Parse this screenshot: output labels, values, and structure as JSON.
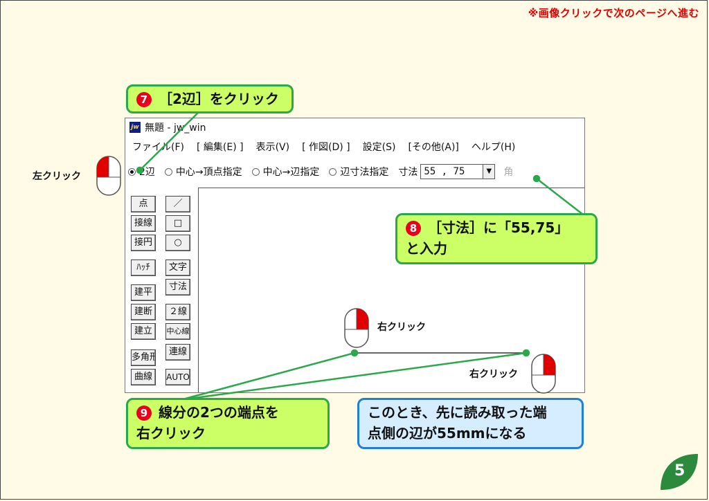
{
  "page": {
    "nav_note": "※画像クリックで次のページへ進む",
    "page_number": "5"
  },
  "window": {
    "icon_text": "jw",
    "title": "無題 - jw_win",
    "menu": [
      {
        "label": "ファイル(F)"
      },
      {
        "label": "[ 編集(E) ]"
      },
      {
        "label": "表示(V)"
      },
      {
        "label": "[ 作図(D) ]"
      },
      {
        "label": "設定(S)"
      },
      {
        "label": "[その他(A)]"
      },
      {
        "label": "ヘルプ(H)"
      }
    ],
    "toolbar": {
      "options": [
        {
          "label": "2辺",
          "selected": true
        },
        {
          "label": "中心→頂点指定",
          "selected": false
        },
        {
          "label": "中心→辺指定",
          "selected": false
        },
        {
          "label": "辺寸法指定",
          "selected": false
        }
      ],
      "size_label": "寸法",
      "size_value": "55 , 75",
      "overflow_text": "角"
    },
    "tools_left": [
      "点",
      "接線",
      "接円",
      "ﾊｯﾁ",
      "建平",
      "建断",
      "建立",
      "多角形",
      "曲線"
    ],
    "tools_right": [
      "／",
      "□",
      "○",
      "文字",
      "寸法",
      "２線",
      "中心線",
      "連線",
      "AUTO"
    ]
  },
  "callouts": {
    "step7": {
      "number": "7",
      "text": "［2辺］をクリック"
    },
    "step8": {
      "number": "8",
      "line1": "［寸法］に「55,75」",
      "line2": "と入力"
    },
    "step9": {
      "number": "9",
      "line1": "線分の2つの端点を",
      "line2": "右クリック"
    },
    "note": {
      "line1": "このとき、先に読み取った端",
      "line2": "点側の辺が55mmになる"
    }
  },
  "captions": {
    "left_click": "左クリック",
    "right_click_1": "右クリック",
    "right_click_2": "右クリック"
  },
  "colors": {
    "callout_border": "#2aa84a",
    "callout_fill": "#ccff66",
    "note_border": "#1f7fd0",
    "note_fill": "#d6ecff",
    "step_badge": "#e8001c",
    "nav_note": "#e00000",
    "page_leaf": "#2c8a3c"
  }
}
